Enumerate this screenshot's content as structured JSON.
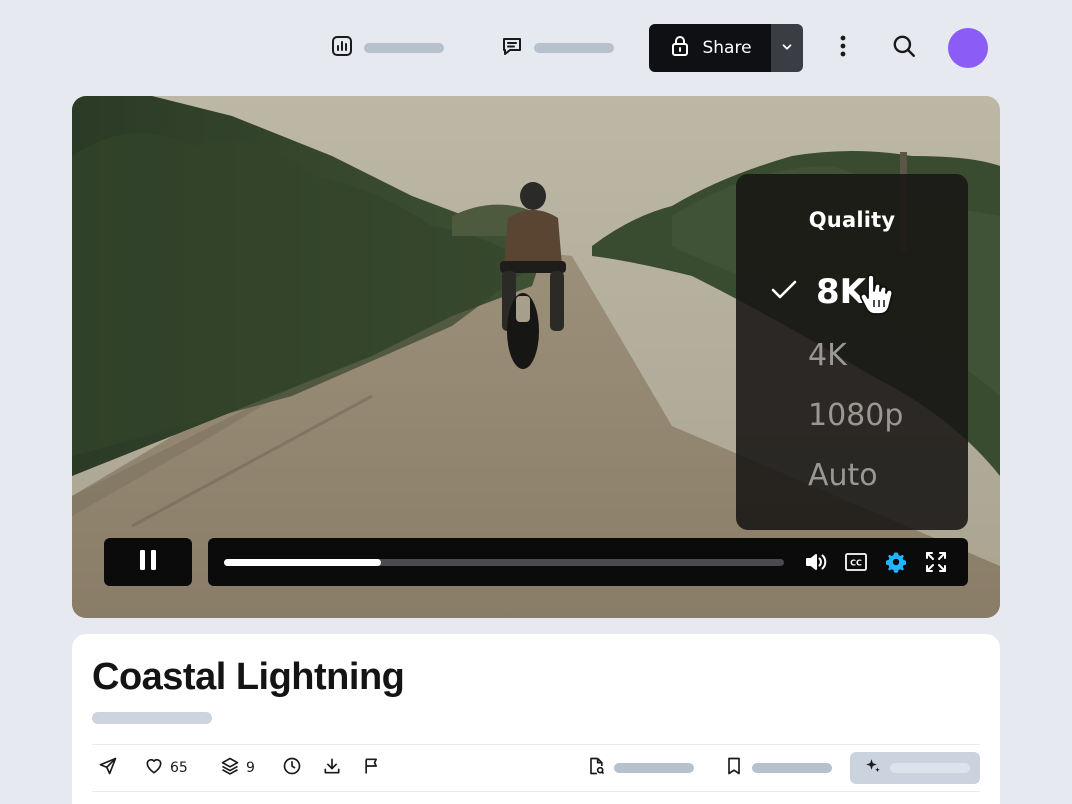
{
  "topbar": {
    "share_label": "Share"
  },
  "video": {
    "progress": 0.28,
    "quality_menu": {
      "title": "Quality",
      "options": [
        "8K",
        "4K",
        "1080p",
        "Auto"
      ],
      "selected": "8K"
    }
  },
  "info": {
    "title": "Coastal Lightning",
    "likes": "65",
    "layers": "9"
  },
  "colors": {
    "accent_settings": "#1fb6ff",
    "avatar": "#8b5cf6",
    "share_bg": "#0f1013",
    "page_bg": "#e6e9f0"
  },
  "icons": [
    "chart-icon",
    "comment-icon",
    "lock-icon",
    "chevron-down-icon",
    "more-vertical-icon",
    "search-icon",
    "pause-icon",
    "volume-icon",
    "cc-icon",
    "gear-icon",
    "fullscreen-icon",
    "send-icon",
    "heart-icon",
    "layers-icon",
    "clock-icon",
    "download-icon",
    "flag-icon",
    "document-search-icon",
    "bookmark-icon",
    "sparkle-icon"
  ]
}
